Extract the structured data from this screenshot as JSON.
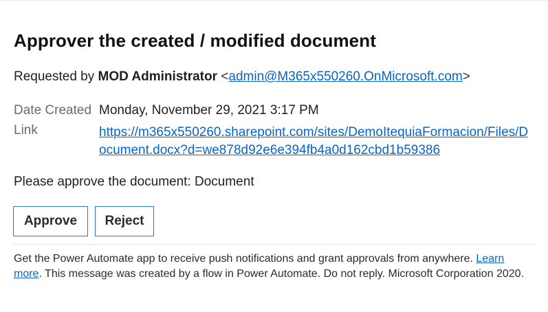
{
  "email": {
    "title": "Approver the created / modified document",
    "requested_by_label": "Requested by",
    "requester_name": "MOD Administrator",
    "requester_email": "admin@M365x550260.OnMicrosoft.com",
    "date_created_label": "Date Created",
    "date_created_value": "Monday, November 29, 2021 3:17 PM",
    "link_label": "Link",
    "link_url": "https://m365x550260.sharepoint.com/sites/DemoItequiaFormacion/Files/Document.docx?d=we878d92e6e394fb4a0d162cbd1b59386",
    "message": "Please approve the document: Document",
    "approve_label": "Approve",
    "reject_label": "Reject",
    "footer_text_1": "Get the Power Automate app to receive push notifications and grant approvals from anywhere. ",
    "footer_learn_more": "Learn more",
    "footer_text_2": ". This message was created by a flow in Power Automate. Do not reply. Microsoft Corporation 2020."
  },
  "colors": {
    "link": "#0a64c2",
    "button_border": "#2f77c4",
    "label_gray": "#6b6b6b"
  }
}
